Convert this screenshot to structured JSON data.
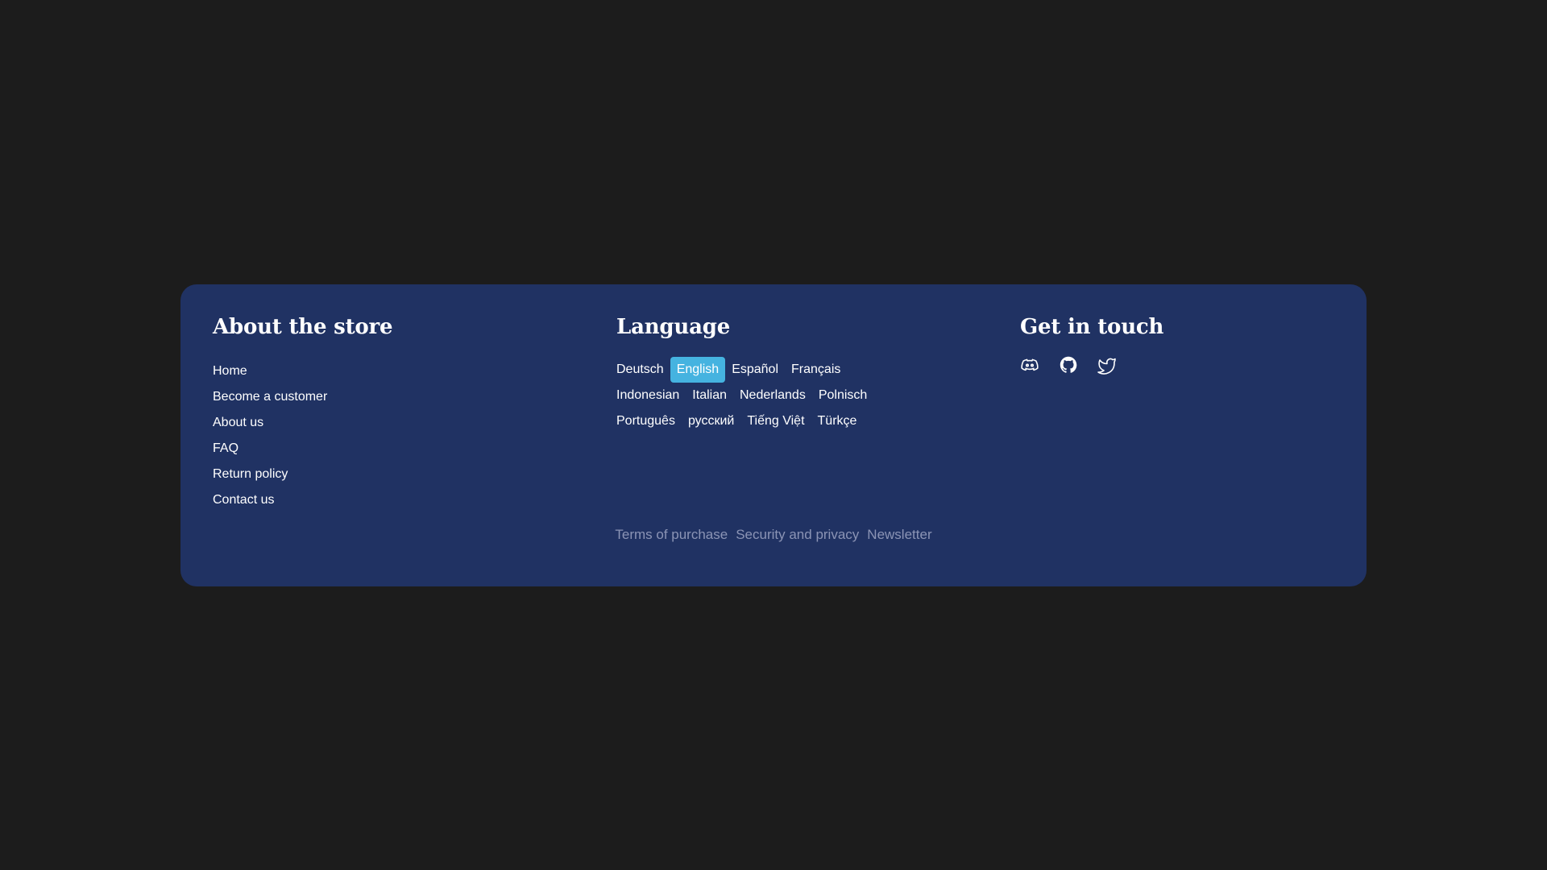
{
  "about": {
    "title": "About the store",
    "links": [
      "Home",
      "Become a customer",
      "About us",
      "FAQ",
      "Return policy",
      "Contact us"
    ]
  },
  "language": {
    "title": "Language",
    "rows": [
      [
        "Deutsch",
        "English",
        "Español",
        "Français"
      ],
      [
        "Indonesian",
        "Italian",
        "Nederlands",
        "Polnisch"
      ],
      [
        "Português",
        "русский",
        "Tiếng Việt",
        "Türkçe"
      ]
    ],
    "selected": "English",
    "accent_color": "#45b3e0"
  },
  "contact": {
    "title": "Get in touch",
    "socials": [
      "discord-icon",
      "github-icon",
      "twitter-icon"
    ]
  },
  "bottom": {
    "terms": "Terms of purchase",
    "security": "Security and privacy",
    "newsletter": "Newsletter"
  },
  "colors": {
    "page_bg": "#1c1c1c",
    "footer_bg": "#203263",
    "muted_link": "#8b94b5"
  }
}
